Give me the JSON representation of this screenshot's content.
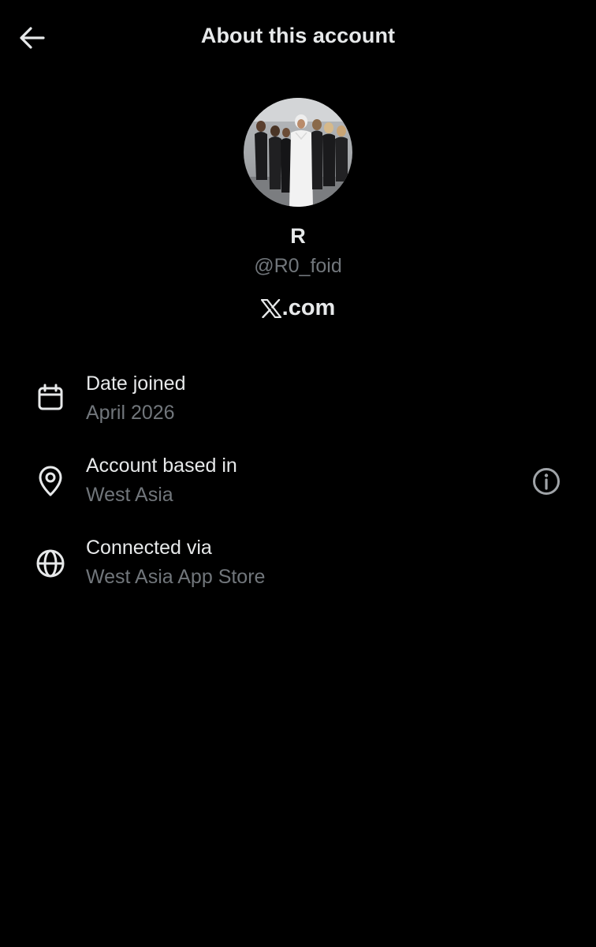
{
  "header": {
    "title": "About this account",
    "back_icon": "arrow-left-icon"
  },
  "profile": {
    "name": "R",
    "handle": "@R0_foid",
    "brand": ".com"
  },
  "details": [
    {
      "icon": "calendar-icon",
      "label": "Date joined",
      "value": "April 2026"
    },
    {
      "icon": "location-pin-icon",
      "label": "Account based in",
      "value": "West Asia",
      "extra_icon": "info-icon"
    },
    {
      "icon": "globe-icon",
      "label": "Connected via",
      "value": "West Asia App Store"
    }
  ],
  "colors": {
    "background": "#000000",
    "primary_text": "#e7e9ea",
    "secondary_text": "#71767b"
  }
}
